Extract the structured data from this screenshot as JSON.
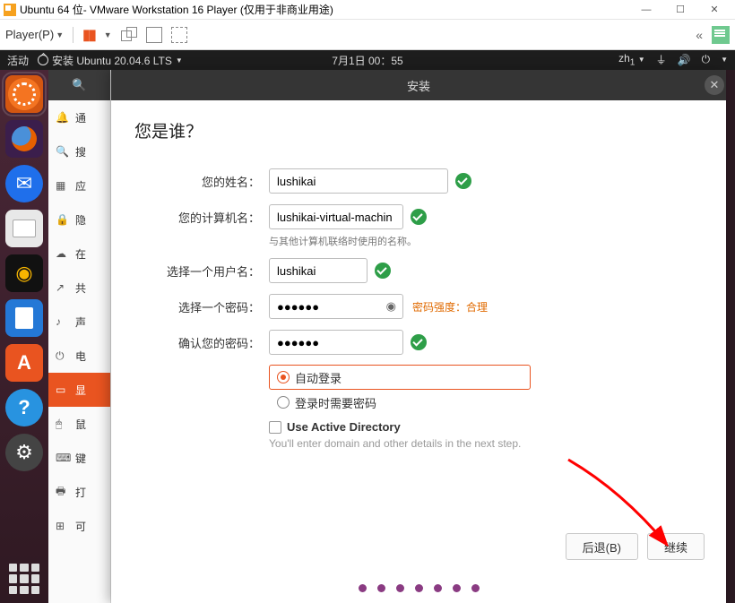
{
  "window": {
    "title": "Ubuntu 64 位- VMware Workstation 16 Player (仅用于非商业用途)"
  },
  "vmtoolbar": {
    "player": "Player(P)"
  },
  "ubuntu_top": {
    "activities": "活动",
    "app_title": "安装 Ubuntu 20.04.6 LTS",
    "clock": "7月1日  00：55",
    "lang": "zh"
  },
  "settings_items": [
    {
      "icon": "🔔",
      "label": "通"
    },
    {
      "icon": "🔍",
      "label": "搜"
    },
    {
      "icon": "▦",
      "label": "应"
    },
    {
      "icon": "🔒",
      "label": "隐"
    },
    {
      "icon": "☁",
      "label": "在"
    },
    {
      "icon": "↗",
      "label": "共"
    },
    {
      "icon": "♪",
      "label": "声"
    },
    {
      "icon": "⏻",
      "label": "电"
    },
    {
      "icon": "▭",
      "label": "显",
      "sel": true
    },
    {
      "icon": "🖱",
      "label": "鼠"
    },
    {
      "icon": "⌨",
      "label": "键"
    },
    {
      "icon": "🖶",
      "label": "打"
    },
    {
      "icon": "⊞",
      "label": "可"
    }
  ],
  "dialog": {
    "title": "安装",
    "heading": "您是谁？",
    "labels": {
      "name": "您的姓名：",
      "computer": "您的计算机名：",
      "computer_hint": "与其他计算机联络时使用的名称。",
      "username": "选择一个用户名：",
      "password": "选择一个密码：",
      "confirm": "确认您的密码：",
      "strength_label": "密码强度：",
      "strength_value": "合理",
      "auto_login": "自动登录",
      "require_pw": "登录时需要密码",
      "ad": "Use Active Directory",
      "ad_hint": "You'll enter domain and other details in the next step."
    },
    "values": {
      "name": "lushikai",
      "computer": "lushikai-virtual-machin",
      "username": "lushikai",
      "password": "●●●●●●",
      "confirm": "●●●●●●"
    },
    "buttons": {
      "back": "后退(B)",
      "continue": "继续"
    }
  }
}
